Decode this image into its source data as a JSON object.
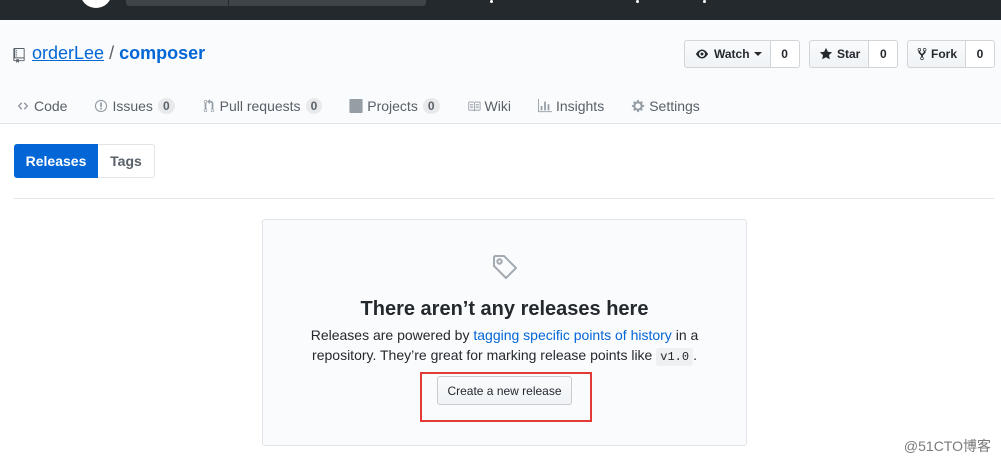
{
  "repo": {
    "owner": "orderLee",
    "separator": "/",
    "name": "composer"
  },
  "actions": {
    "watch_label": "Watch",
    "watch_count": "0",
    "star_label": "Star",
    "star_count": "0",
    "fork_label": "Fork",
    "fork_count": "0"
  },
  "tabs": [
    {
      "label": "Code",
      "icon": "code-icon"
    },
    {
      "label": "Issues",
      "icon": "issue-icon",
      "count": "0"
    },
    {
      "label": "Pull requests",
      "icon": "pull-request-icon",
      "count": "0"
    },
    {
      "label": "Projects",
      "icon": "project-icon",
      "count": "0"
    },
    {
      "label": "Wiki",
      "icon": "book-icon"
    },
    {
      "label": "Insights",
      "icon": "graph-icon"
    },
    {
      "label": "Settings",
      "icon": "gear-icon"
    }
  ],
  "subnav": {
    "releases_label": "Releases",
    "tags_label": "Tags"
  },
  "blankslate": {
    "icon": "tag-icon",
    "title": "There aren’t any releases here",
    "text_before_link": "Releases are powered by ",
    "link_text": "tagging specific points of history",
    "text_after_link": " in a",
    "text_line2": "repository. They’re great for marking release points like ",
    "code_example": "v1.0",
    "text_end": ".",
    "button_label": "Create a new release"
  },
  "watermark": "@51CTO博客",
  "colors": {
    "accent": "#0366d6",
    "header_bg": "#24292e",
    "highlight": "#e53935"
  }
}
